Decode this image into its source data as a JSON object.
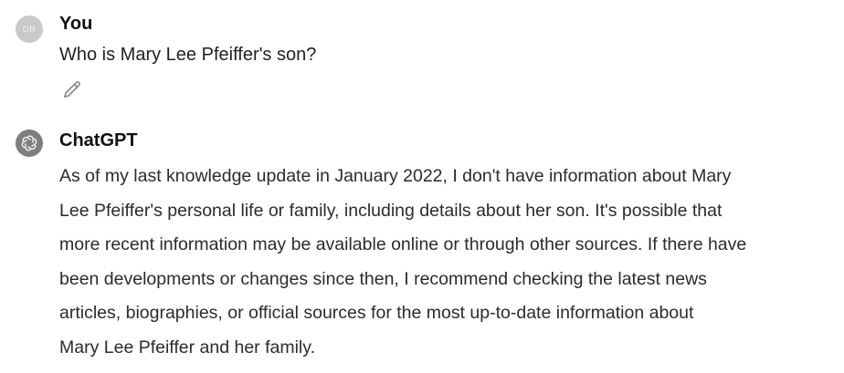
{
  "conversation": {
    "user": {
      "avatar_initials": "OR",
      "author": "You",
      "message": "Who is Mary Lee Pfeiffer's son?",
      "edit_icon": "pencil-icon"
    },
    "assistant": {
      "avatar_icon": "openai-logo-icon",
      "author": "ChatGPT",
      "lines": [
        "As of my last knowledge update in January 2022, I don't have information about Mary",
        "Lee Pfeiffer's personal life or family, including details about her son. It's possible that",
        "more recent information may be available online or through other sources. If there have",
        "been developments or changes since then, I recommend checking the latest news",
        "articles, biographies, or official sources for the most up-to-date information about",
        "Mary Lee Pfeiffer and her family."
      ]
    }
  }
}
